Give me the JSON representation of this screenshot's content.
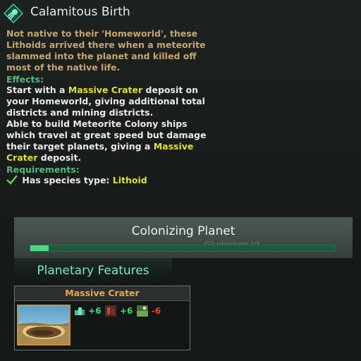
{
  "trait": {
    "title": "Calamitous Birth",
    "icon": "meteor-trait-icon",
    "lore": "Not native to their 'Homeworld', these Lithoids arrived there when a meteorite slammed into the planet and killed off most of the native life.",
    "effects_label": "Effects:",
    "effects": {
      "p1_a": "Start with a ",
      "p1_hl": "Massive Crater",
      "p1_b": " deposit on your Homeworld, giving additional total districts and mining districts.",
      "p2_a": "Able to build Meteorite Colony ships which travel at great speed but damage their target planets, giving a ",
      "p2_hl": "Massive Crater",
      "p2_b": " deposit."
    },
    "requirements_label": "Requirements:",
    "requirement_text": "Has species type: ",
    "requirement_value": "Lithoid",
    "requirement_met": true
  },
  "colonizing": {
    "title": "Colonizing Planet",
    "background_text": "Glyderium VI",
    "progress": 0.06
  },
  "features": {
    "title": "Planetary Features",
    "items": [
      {
        "name": "Massive Crater",
        "modifiers": [
          {
            "icon": "total-districts-icon",
            "value": "+6",
            "sign": "positive"
          },
          {
            "icon": "mining-district-icon",
            "value": "+6",
            "sign": "positive"
          },
          {
            "icon": "planet-habitability-icon",
            "value": "-6",
            "sign": "negative"
          }
        ]
      }
    ]
  },
  "colors": {
    "lore": "#c9a36f",
    "section_heading": "#57b87d",
    "highlight": "#e2de3c",
    "feature_name": "#e8a74a",
    "positive": "#49d86b",
    "negative": "#e8423a",
    "progress": "#4fd87f"
  }
}
